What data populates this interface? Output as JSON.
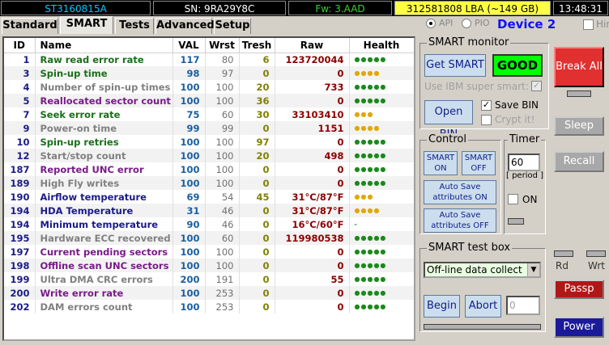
{
  "topbar": {
    "model": "ST3160815A",
    "serial": "SN: 9RA29Y8C",
    "firmware": "Fw: 3.AAD",
    "lba": "312581808 LBA (~149 GB)",
    "time": "13:48:31"
  },
  "tabs": [
    {
      "label": "Standard",
      "active": false
    },
    {
      "label": "SMART",
      "active": true
    },
    {
      "label": "Tests",
      "active": false
    },
    {
      "label": "Advanced",
      "active": false
    },
    {
      "label": "Setup",
      "active": false
    }
  ],
  "interface": {
    "api_label": "API",
    "pio_label": "PIO",
    "selected": "API"
  },
  "device_label": "Device 2",
  "hints_label": "Hints",
  "table": {
    "headers": [
      "ID",
      "Name",
      "VAL",
      "Wrst",
      "Tresh",
      "Raw",
      "Health"
    ],
    "rows": [
      {
        "id": "1",
        "name": "Raw read error rate",
        "val": "117",
        "wrst": "80",
        "tresh": "6",
        "raw": "123720044",
        "health": "●●●●●",
        "name_color": "#1a6e1a",
        "health_color": "#1a8a1a"
      },
      {
        "id": "3",
        "name": "Spin-up time",
        "val": "98",
        "wrst": "97",
        "tresh": "0",
        "raw": "0",
        "health": "●●●●",
        "name_color": "#1a6e1a",
        "health_color": "#e0a800"
      },
      {
        "id": "4",
        "name": "Number of spin-up times",
        "val": "100",
        "wrst": "100",
        "tresh": "20",
        "raw": "733",
        "health": "●●●●●",
        "name_color": "#808080",
        "health_color": "#1a8a1a"
      },
      {
        "id": "5",
        "name": "Reallocated sector count",
        "val": "100",
        "wrst": "100",
        "tresh": "36",
        "raw": "0",
        "health": "●●●●●",
        "name_color": "#7a1a8a",
        "health_color": "#1a8a1a"
      },
      {
        "id": "7",
        "name": "Seek error rate",
        "val": "75",
        "wrst": "60",
        "tresh": "30",
        "raw": "33103410",
        "health": "●●●",
        "name_color": "#1a6e1a",
        "health_color": "#e0a800"
      },
      {
        "id": "9",
        "name": "Power-on time",
        "val": "99",
        "wrst": "99",
        "tresh": "0",
        "raw": "1151",
        "health": "●●●●",
        "name_color": "#808080",
        "health_color": "#e0a800"
      },
      {
        "id": "10",
        "name": "Spin-up retries",
        "val": "100",
        "wrst": "100",
        "tresh": "97",
        "raw": "0",
        "health": "●●●●●",
        "name_color": "#1a6e1a",
        "health_color": "#1a8a1a"
      },
      {
        "id": "12",
        "name": "Start/stop count",
        "val": "100",
        "wrst": "100",
        "tresh": "20",
        "raw": "498",
        "health": "●●●●●",
        "name_color": "#808080",
        "health_color": "#1a8a1a"
      },
      {
        "id": "187",
        "name": "Reported UNC error",
        "val": "100",
        "wrst": "100",
        "tresh": "0",
        "raw": "0",
        "health": "●●●●●",
        "name_color": "#7a1a8a",
        "health_color": "#1a8a1a"
      },
      {
        "id": "189",
        "name": "High Fly writes",
        "val": "100",
        "wrst": "100",
        "tresh": "0",
        "raw": "0",
        "health": "●●●●●",
        "name_color": "#808080",
        "health_color": "#1a8a1a"
      },
      {
        "id": "190",
        "name": "Airflow temperature",
        "val": "69",
        "wrst": "54",
        "tresh": "45",
        "raw": "31°C/87°F",
        "health": "●●●",
        "name_color": "#1a1a8a",
        "health_color": "#e0a800"
      },
      {
        "id": "194",
        "name": "HDA Temperature",
        "val": "31",
        "wrst": "46",
        "tresh": "0",
        "raw": "31°C/87°F",
        "health": "●●●●",
        "name_color": "#1a1a8a",
        "health_color": "#e0a800"
      },
      {
        "id": "194",
        "name": "Minimum temperature",
        "val": "90",
        "wrst": "46",
        "tresh": "0",
        "raw": "16°C/60°F",
        "health": "-",
        "name_color": "#1a1a8a",
        "health_color": "#1a8a1a"
      },
      {
        "id": "195",
        "name": "Hardware ECC recovered",
        "val": "100",
        "wrst": "60",
        "tresh": "0",
        "raw": "119980538",
        "health": "●●●●●",
        "name_color": "#808080",
        "health_color": "#1a8a1a"
      },
      {
        "id": "197",
        "name": "Current pending sectors",
        "val": "100",
        "wrst": "100",
        "tresh": "0",
        "raw": "0",
        "health": "●●●●●",
        "name_color": "#7a1a8a",
        "health_color": "#1a8a1a"
      },
      {
        "id": "198",
        "name": "Offline scan UNC sectors",
        "val": "100",
        "wrst": "100",
        "tresh": "0",
        "raw": "0",
        "health": "●●●●●",
        "name_color": "#7a1a8a",
        "health_color": "#1a8a1a"
      },
      {
        "id": "199",
        "name": "Ultra DMA CRC errors",
        "val": "200",
        "wrst": "191",
        "tresh": "0",
        "raw": "55",
        "health": "●●●●●",
        "name_color": "#808080",
        "health_color": "#1a8a1a"
      },
      {
        "id": "200",
        "name": "Write error rate",
        "val": "100",
        "wrst": "253",
        "tresh": "0",
        "raw": "0",
        "health": "●●●●●",
        "name_color": "#7a1a8a",
        "health_color": "#1a8a1a"
      },
      {
        "id": "202",
        "name": "DAM errors count",
        "val": "100",
        "wrst": "253",
        "tresh": "0",
        "raw": "0",
        "health": "●●●●●",
        "name_color": "#808080",
        "health_color": "#1a8a1a"
      }
    ]
  },
  "smart_monitor": {
    "title": "SMART monitor",
    "get_smart": "Get SMART",
    "status": "GOOD",
    "ibm_label": "Use IBM super smart:",
    "open_bin": "Open BIN",
    "save_bin": "Save BIN",
    "crypt": "Crypt it!"
  },
  "control": {
    "title": "Control",
    "smart_on": "SMART ON",
    "smart_off": "SMART OFF",
    "autosave_on": "Auto Save attributes ON",
    "autosave_off": "Auto Save attributes OFF"
  },
  "timer": {
    "title": "Timer",
    "value": "60",
    "period_label": "[ period ]",
    "on_label": "ON"
  },
  "test_box": {
    "title": "SMART test box",
    "selected_test": "Off-line data collect",
    "begin": "Begin",
    "abort": "Abort",
    "progress_value": "0"
  },
  "side": {
    "break_all": "Break All",
    "sleep": "Sleep",
    "recall": "Recall",
    "rd": "Rd",
    "wrt": "Wrt",
    "passp": "Passp",
    "power": "Power"
  }
}
